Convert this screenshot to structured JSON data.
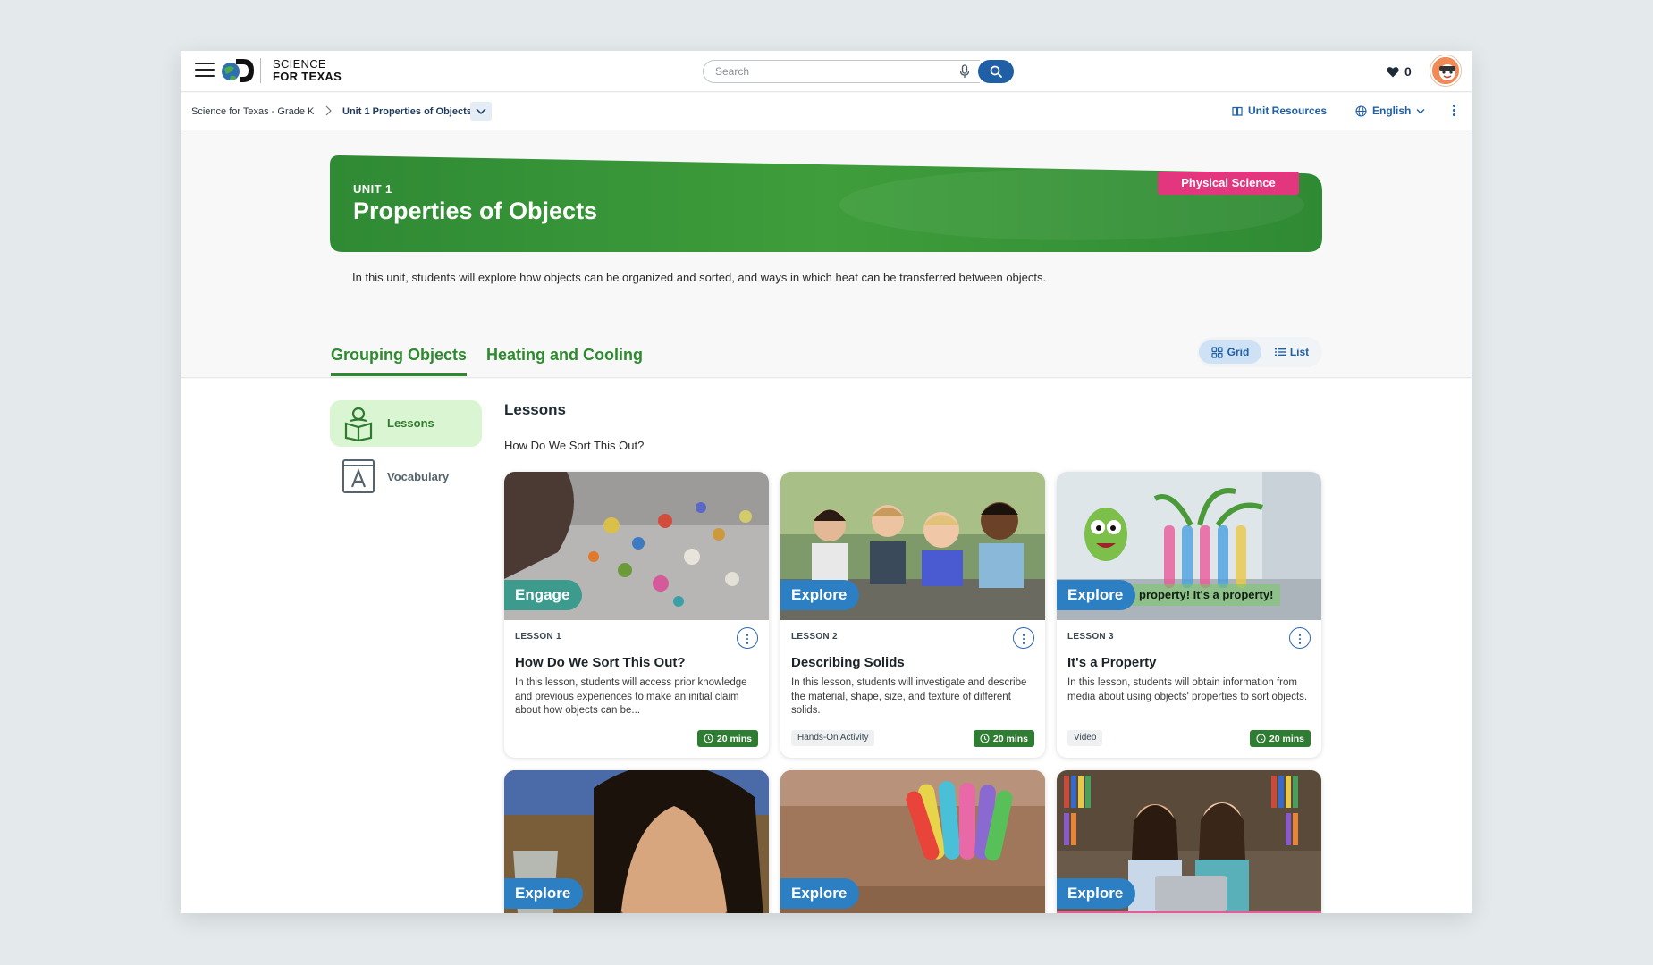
{
  "header": {
    "brand_line1": "SCIENCE",
    "brand_line2": "FOR TEXAS",
    "search_placeholder": "Search",
    "favorites_count": "0"
  },
  "breadcrumb": {
    "items": [
      "Science for Texas - Grade K",
      "Unit 1 Properties of Objects"
    ],
    "unit_resources": "Unit Resources",
    "language": "English"
  },
  "banner": {
    "unit_label": "UNIT 1",
    "title": "Properties of Objects",
    "tag": "Physical Science",
    "description": "In this unit, students will explore how objects can be organized and sorted, and ways in which heat can be transferred between objects."
  },
  "tabs": [
    {
      "label": "Grouping Objects",
      "active": true
    },
    {
      "label": "Heating and Cooling",
      "active": false
    }
  ],
  "view_toggle": {
    "grid": "Grid",
    "list": "List",
    "selected": "Grid"
  },
  "sidebar": {
    "items": [
      {
        "label": "Lessons",
        "active": true
      },
      {
        "label": "Vocabulary",
        "active": false
      }
    ]
  },
  "main": {
    "section_title": "Lessons",
    "section_subtitle": "How Do We Sort This Out?"
  },
  "cards": [
    {
      "phase": "Engage",
      "number": "LESSON 1",
      "title": "How Do We Sort This Out?",
      "description": "In this lesson, students will access prior knowledge and previous experiences to make an initial claim about how objects can be...",
      "chip": "",
      "duration": "20 mins"
    },
    {
      "phase": "Explore",
      "number": "LESSON 2",
      "title": "Describing Solids",
      "description": "In this lesson, students will investigate and describe the material, shape, size, and texture of different solids.",
      "chip": "Hands-On Activity",
      "duration": "20 mins"
    },
    {
      "phase": "Explore",
      "number": "LESSON 3",
      "title": "It's a Property",
      "description": "In this lesson, students will obtain information from media about using objects' properties to sort objects.",
      "chip": "Video",
      "duration": "20 mins",
      "caption": "property! It's a property!"
    },
    {
      "phase": "Explore"
    },
    {
      "phase": "Explore"
    },
    {
      "phase": "Explore"
    }
  ],
  "colors": {
    "primary_blue": "#1f5fa6",
    "brand_green": "#2e8a2e",
    "banner_green": "#3a9a3a",
    "tag_pink": "#e2377f",
    "engage_teal": "#3c9b8c",
    "explore_blue": "#2b7fc2"
  },
  "icons": [
    "menu-icon",
    "discovery-education-logo",
    "mic-icon",
    "search-icon",
    "heart-icon",
    "book-open-icon",
    "globe-icon",
    "chevron-down-icon",
    "chevron-right-icon",
    "more-vertical-icon",
    "grid-icon",
    "list-icon",
    "reading-student-icon",
    "vocabulary-book-icon",
    "clock-icon"
  ]
}
